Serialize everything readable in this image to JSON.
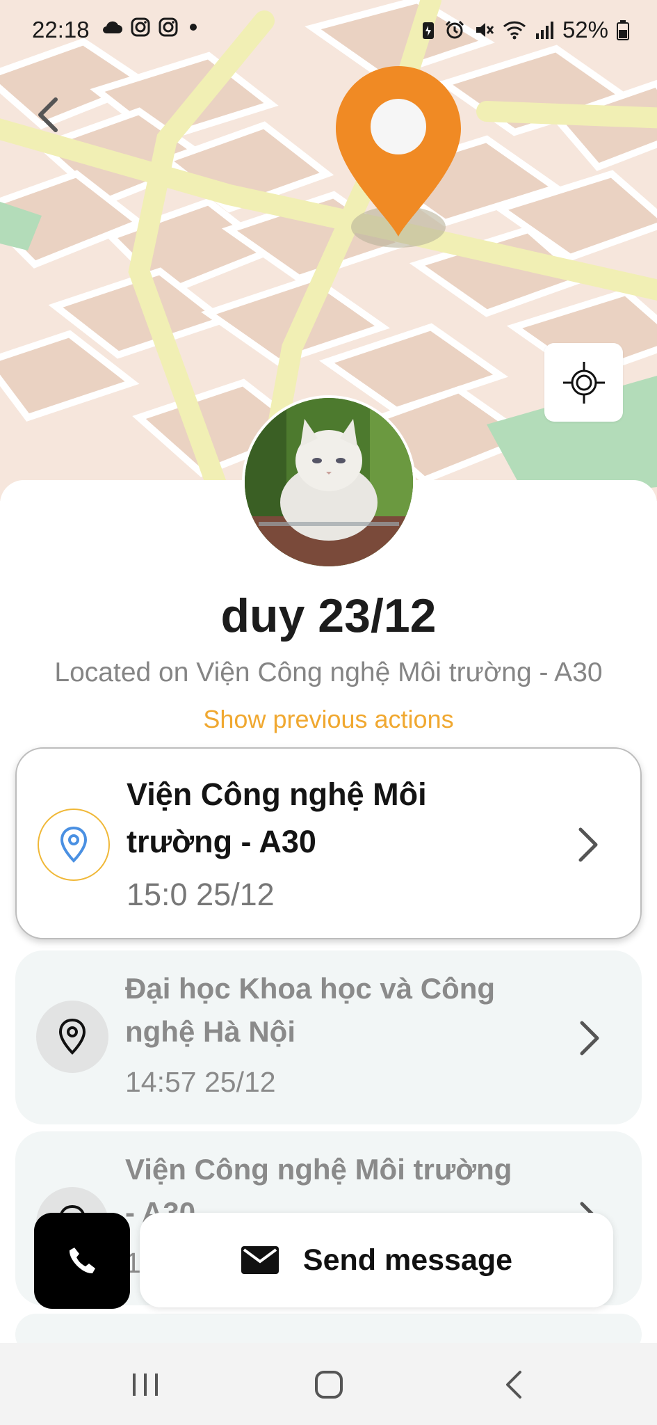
{
  "status_bar": {
    "time": "22:18",
    "left_icons": [
      "cloud-icon",
      "instagram-icon",
      "instagram-icon",
      "dot-icon"
    ],
    "right_icons": [
      "battery-saver-icon",
      "alarm-icon",
      "mute-icon",
      "wifi-icon",
      "signal-icon"
    ],
    "battery": "52%"
  },
  "map": {
    "back_icon": "chevron-left-icon",
    "locate_icon": "crosshair-icon",
    "pin_color": "#f08a24"
  },
  "profile": {
    "name": "duy 23/12",
    "location_text": "Located on Viện Công nghệ Môi trường - A30",
    "show_previous": "Show previous actions"
  },
  "history": [
    {
      "place": "Viện Công nghệ Môi trường - A30",
      "time": "15:0 25/12",
      "active": true
    },
    {
      "place": "Đại học Khoa học và Công nghệ Hà Nội",
      "time": "14:57 25/12",
      "active": false
    },
    {
      "place": "Viện Công nghệ Môi trường - A30",
      "time": "1",
      "active": false
    }
  ],
  "actions": {
    "call_icon": "phone-icon",
    "message_icon": "mail-icon",
    "message_label": "Send message"
  },
  "nav": [
    "recents-icon",
    "home-icon",
    "back-icon"
  ],
  "colors": {
    "accent": "#f0a830",
    "pin": "#f08a24",
    "map_road": "#f3f0b5",
    "map_block": "#ead9cc"
  }
}
